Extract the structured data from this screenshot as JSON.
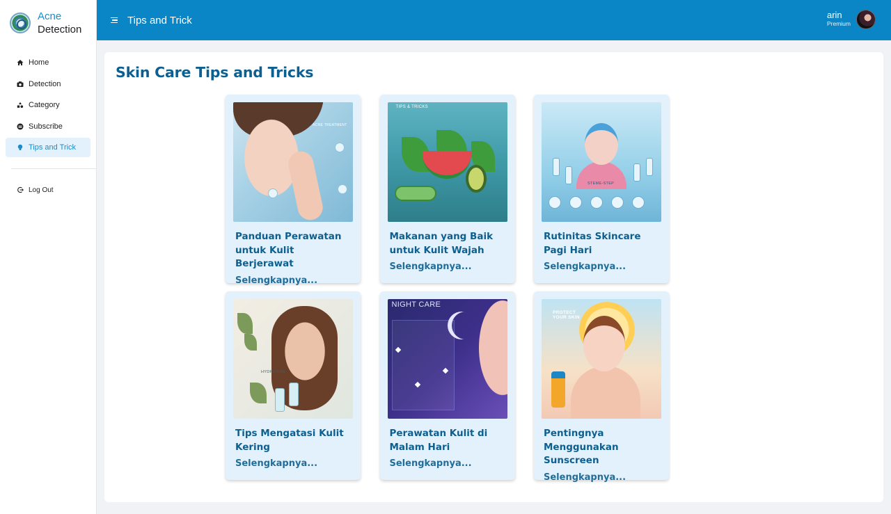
{
  "brand": {
    "line1": "Acne",
    "line2": "Detection"
  },
  "sidebar": {
    "items": [
      {
        "label": "Home",
        "icon": "home-icon"
      },
      {
        "label": "Detection",
        "icon": "camera-icon"
      },
      {
        "label": "Category",
        "icon": "category-icon"
      },
      {
        "label": "Subscribe",
        "icon": "subscribe-icon"
      },
      {
        "label": "Tips and Trick",
        "icon": "lightbulb-icon",
        "active": true
      }
    ],
    "logout": {
      "label": "Log Out",
      "icon": "logout-icon"
    }
  },
  "header": {
    "title": "Tips and Trick",
    "user": {
      "name": "arin",
      "plan": "Premium"
    }
  },
  "main": {
    "title": "Skin Care Tips and Tricks",
    "cards": [
      {
        "title": "Panduan Perawatan untuk Kulit Berjerawat",
        "more": "Selengkapnya...",
        "image_label": "ACNE TREATMENT"
      },
      {
        "title": "Makanan yang Baik untuk Kulit Wajah",
        "more": "Selengkapnya...",
        "image_label": "TIPS & TRICKS"
      },
      {
        "title": "Rutinitas Skincare Pagi Hari",
        "more": "Selengkapnya...",
        "image_label": "STEME-STEP"
      },
      {
        "title": "Tips Mengatasi Kulit Kering",
        "more": "Selengkapnya...",
        "image_label": "HYDRATION"
      },
      {
        "title": "Perawatan Kulit di Malam Hari",
        "more": "Selengkapnya...",
        "image_label": "NIGHT CARE"
      },
      {
        "title": "Pentingnya Menggunakan Sunscreen",
        "more": "Selengkapnya...",
        "image_label": "PROTECT YOUR SKIN"
      }
    ]
  },
  "colors": {
    "header_bg": "#0a86c6",
    "accent": "#1b8cc9",
    "title_text": "#0d5f8f",
    "card_bg": "#e3f1fc",
    "active_nav_bg": "#e3f1fc"
  }
}
